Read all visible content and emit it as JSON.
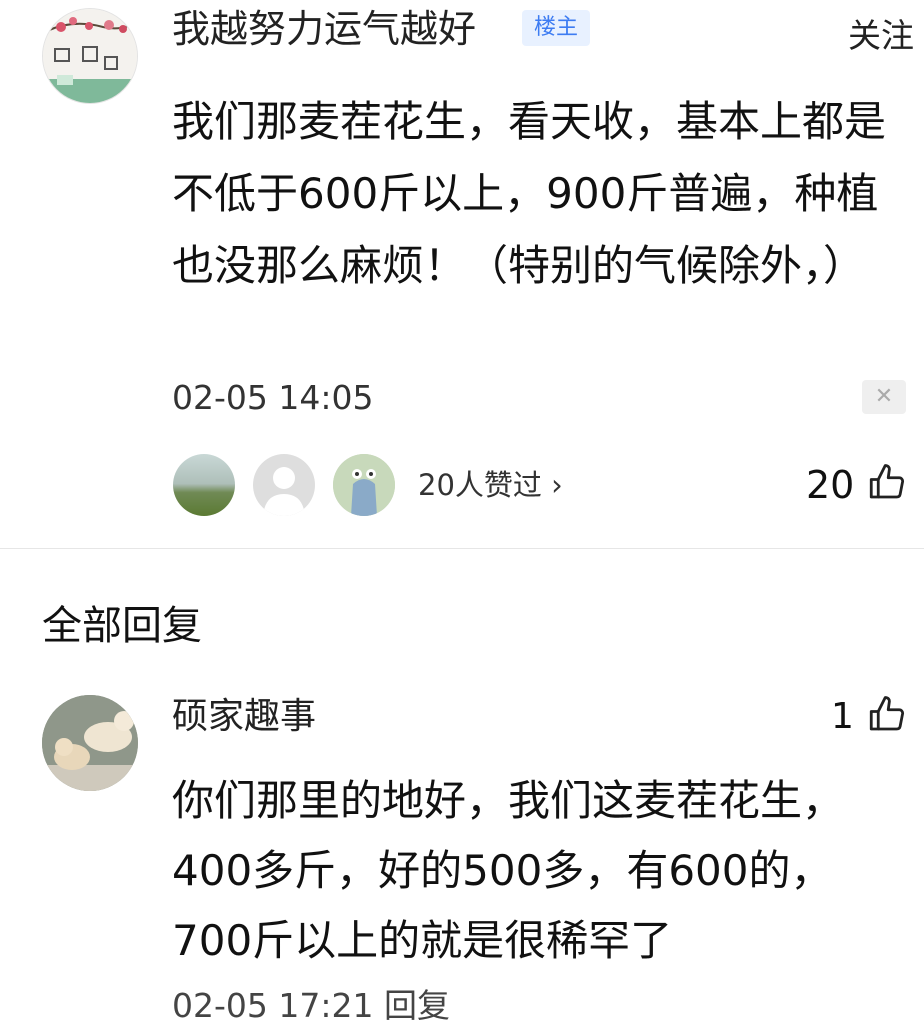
{
  "post": {
    "author": "我越努力运气越好",
    "badge": "楼主",
    "follow_label": "关注",
    "content": "我们那麦茬花生，看天收，基本上都是不低于600斤以上，900斤普遍，种植也没那么麻烦！（特别的气候除外，）",
    "time": "02-05 14:05",
    "close_icon": "close-icon",
    "likes_summary": "20人赞过",
    "like_count": "20",
    "like_icon": "thumbs-up-icon"
  },
  "replies_section": {
    "title": "全部回复"
  },
  "reply": {
    "author": "硕家趣事",
    "like_count": "1",
    "like_icon": "thumbs-up-icon",
    "content": "你们那里的地好，我们这麦茬花生，400多斤，好的500多，有600的，700斤以上的就是很稀罕了",
    "time": "02-05 17:21 回复"
  },
  "colors": {
    "badge_text": "#3d7cf2",
    "badge_bg": "#e8f1ff",
    "divider": "#e6e6e6"
  }
}
